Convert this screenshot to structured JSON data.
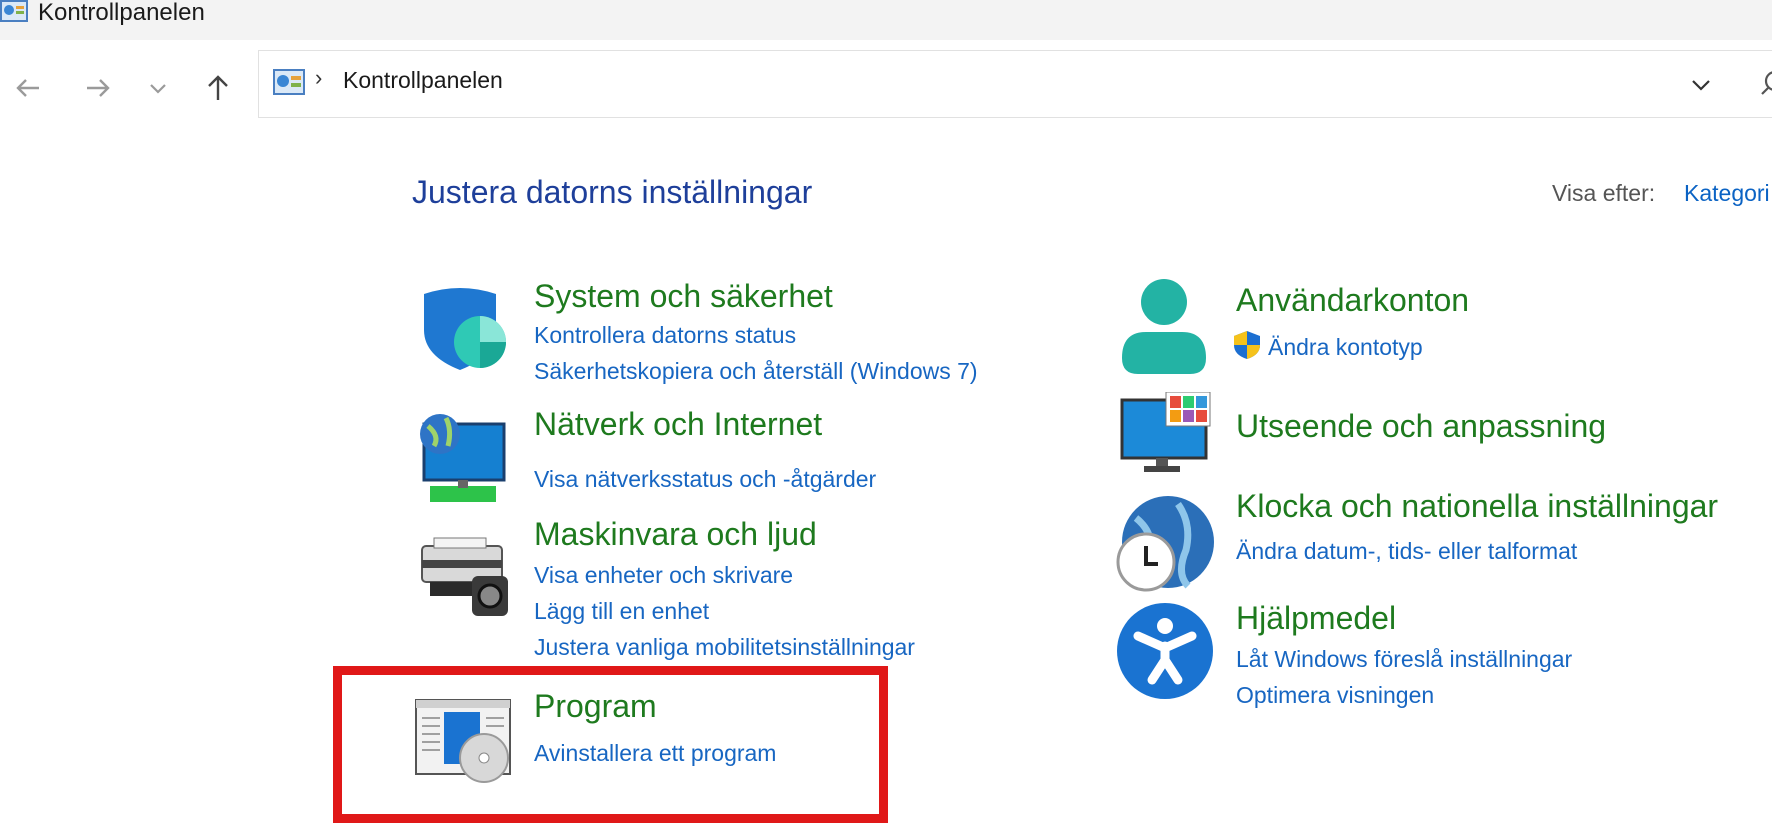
{
  "window": {
    "title": "Kontrollpanelen"
  },
  "address": {
    "crumb": "Kontrollpanelen"
  },
  "heading": "Justera datorns inställningar",
  "view_by": {
    "label": "Visa efter:",
    "value": "Kategori"
  },
  "categories": [
    {
      "title": "System och säkerhet",
      "links": [
        "Kontrollera datorns status",
        "Säkerhetskopiera och återställ (Windows 7)"
      ]
    },
    {
      "title": "Nätverk och Internet",
      "links": [
        "Visa nätverksstatus och -åtgärder"
      ]
    },
    {
      "title": "Maskinvara och ljud",
      "links": [
        "Visa enheter och skrivare",
        "Lägg till en enhet",
        "Justera vanliga mobilitetsinställningar"
      ]
    },
    {
      "title": "Program",
      "links": [
        "Avinstallera ett program"
      ]
    },
    {
      "title": "Användarkonton",
      "links": [
        "Ändra kontotyp"
      ]
    },
    {
      "title": "Utseende och anpassning",
      "links": []
    },
    {
      "title": "Klocka och nationella inställningar",
      "links": [
        "Ändra datum-, tids- eller talformat"
      ]
    },
    {
      "title": "Hjälpmedel",
      "links": [
        "Låt Windows föreslå inställningar",
        "Optimera visningen"
      ]
    }
  ],
  "colors": {
    "heading": "#1e3f9a",
    "category_title": "#1e7a1e",
    "link": "#1766c2",
    "highlight": "#e01818"
  },
  "icons": [
    "back-arrow-icon",
    "forward-arrow-icon",
    "recent-dropdown-icon",
    "up-arrow-icon",
    "control-panel-icon",
    "chevron-down-icon",
    "search-icon",
    "shield-icon",
    "network-monitor-icon",
    "printer-camera-icon",
    "program-disc-icon",
    "user-icon",
    "uac-shield-icon",
    "appearance-monitor-icon",
    "clock-globe-icon",
    "accessibility-icon"
  ]
}
